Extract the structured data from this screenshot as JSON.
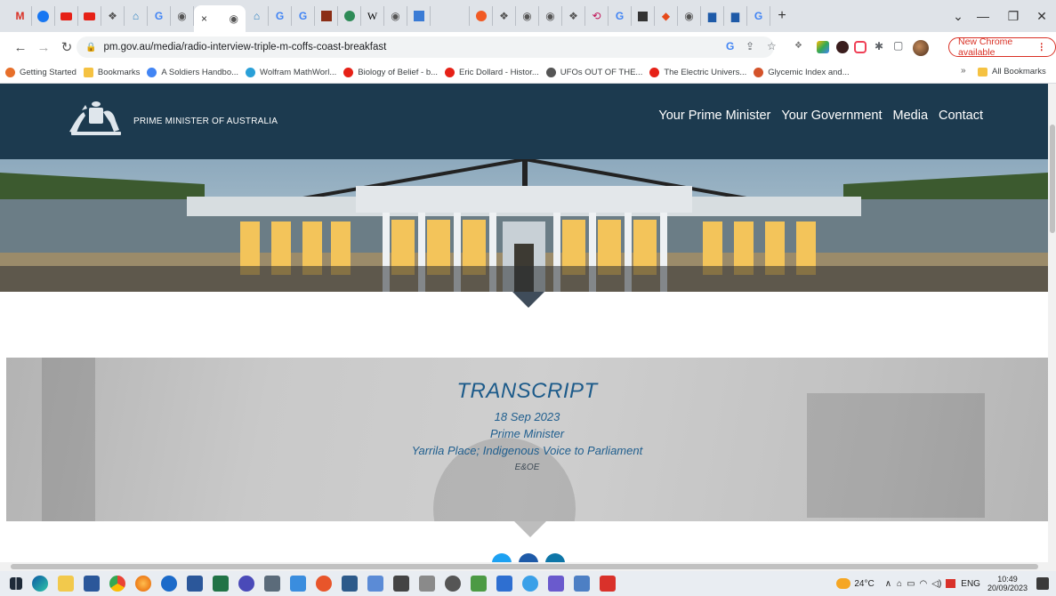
{
  "browser": {
    "url": "pm.gov.au/media/radio-interview-triple-m-coffs-coast-breakfast",
    "update_button": "New Chrome available",
    "bookmarks": [
      {
        "label": "Getting Started",
        "icon": "firefox-icon",
        "color": "#e76f2a"
      },
      {
        "label": "Bookmarks",
        "icon": "folder-icon",
        "color": "#f5c242"
      },
      {
        "label": "A Soldiers Handbo...",
        "icon": "google-icon",
        "color": "#4285f4"
      },
      {
        "label": "Wolfram MathWorl...",
        "icon": "globe-icon",
        "color": "#2aa0d8"
      },
      {
        "label": "Biology of Belief - b...",
        "icon": "youtube-icon",
        "color": "#e62117"
      },
      {
        "label": "Eric Dollard - Histor...",
        "icon": "youtube-icon",
        "color": "#e62117"
      },
      {
        "label": "UFOs OUT OF THE...",
        "icon": "globe-icon",
        "color": "#555"
      },
      {
        "label": "The Electric Univers...",
        "icon": "youtube-icon",
        "color": "#e62117"
      },
      {
        "label": "Glycemic Index and...",
        "icon": "sun-icon",
        "color": "#d4532a"
      }
    ],
    "all_bookmarks": "All Bookmarks",
    "overflow": "»"
  },
  "site": {
    "title": "PRIME MINISTER OF AUSTRALIA",
    "nav": [
      "Your Prime Minister",
      "Your Government",
      "Media",
      "Contact"
    ]
  },
  "transcript": {
    "heading": "TRANSCRIPT",
    "date": "18 Sep 2023",
    "speaker": "Prime Minister",
    "topics": "Yarrila Place; Indigenous Voice to Parliament",
    "eoe": "E&OE"
  },
  "taskbar": {
    "weather": "24°C",
    "lang": "ENG",
    "time": "10:49",
    "date": "20/09/2023"
  },
  "colors": {
    "header_bg": "#1c3a4f",
    "transcript_text": "#1d5b8a",
    "update_red": "#d93025"
  }
}
